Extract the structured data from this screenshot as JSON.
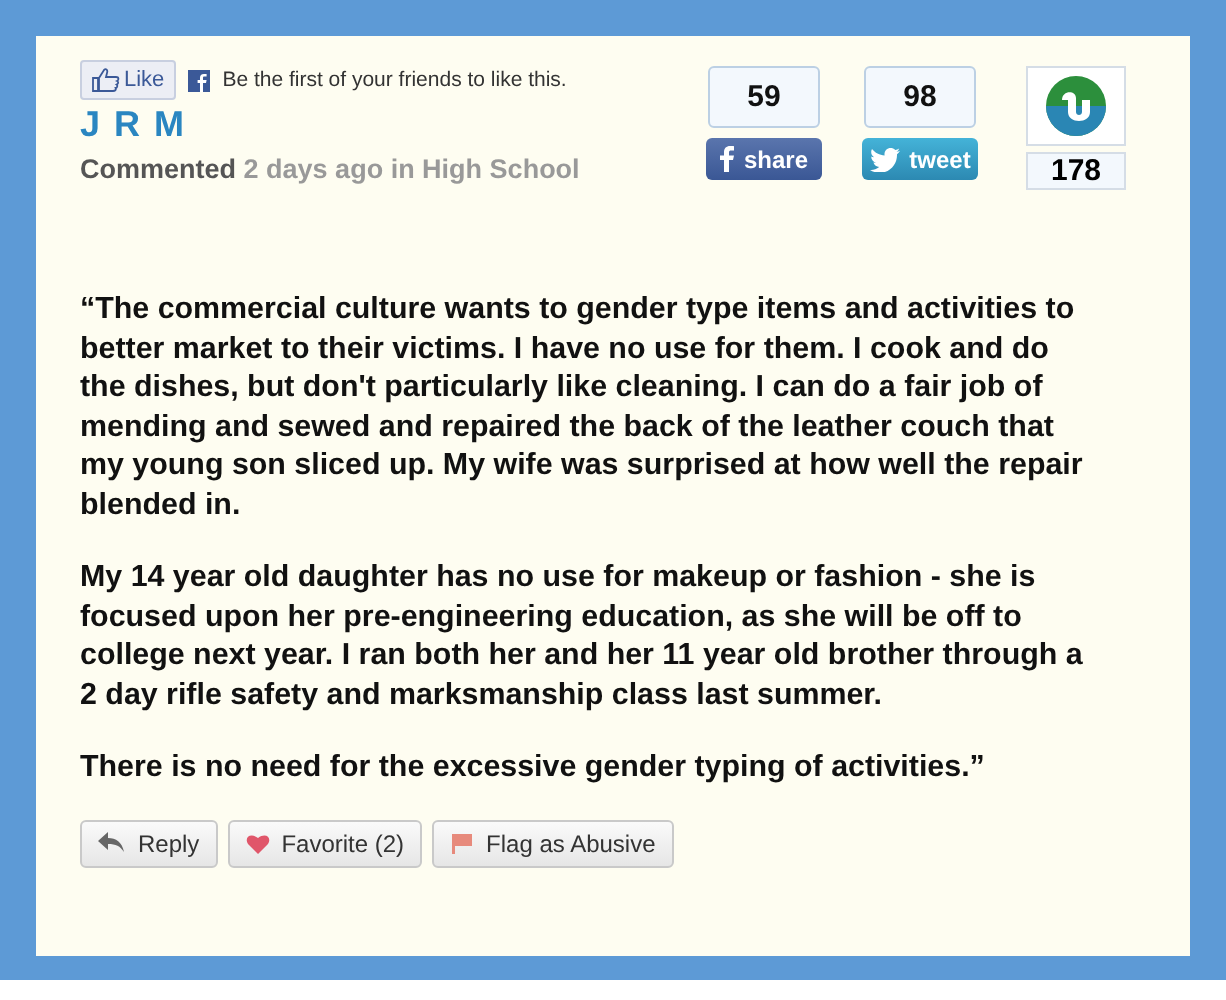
{
  "like": {
    "button": "Like",
    "text": "Be the first of your friends to like this."
  },
  "author": "J R M",
  "meta": {
    "verb": "Commented",
    "detail": "2 days ago in High School"
  },
  "social": [
    {
      "kind": "facebook",
      "count": "59",
      "label": "share"
    },
    {
      "kind": "twitter",
      "count": "98",
      "label": "tweet"
    },
    {
      "kind": "stumbleupon",
      "count": "178"
    }
  ],
  "paragraphs": [
    "“The commercial culture wants to gender type items and activities to better market to their victims. I have no use for them. I cook and do the dishes, but don't particularly like cleaning. I can do a fair job of mending and sewed and repaired the back of the leather couch that my young son sliced up. My wife was surprised at how well the repair blended in.",
    "My 14 year old daughter has no use for makeup or fashion - she is focused upon her pre-engineering education, as she will be off to college next year. I ran both her and her 11 year old brother through a 2 day rifle safety and marksmanship class last summer.",
    "There is no need for the excessive gender typing of activities.”"
  ],
  "actions": [
    {
      "kind": "reply",
      "label": "Reply"
    },
    {
      "kind": "favorite",
      "label": "Favorite (2)"
    },
    {
      "kind": "flag",
      "label": "Flag as Abusive"
    }
  ]
}
